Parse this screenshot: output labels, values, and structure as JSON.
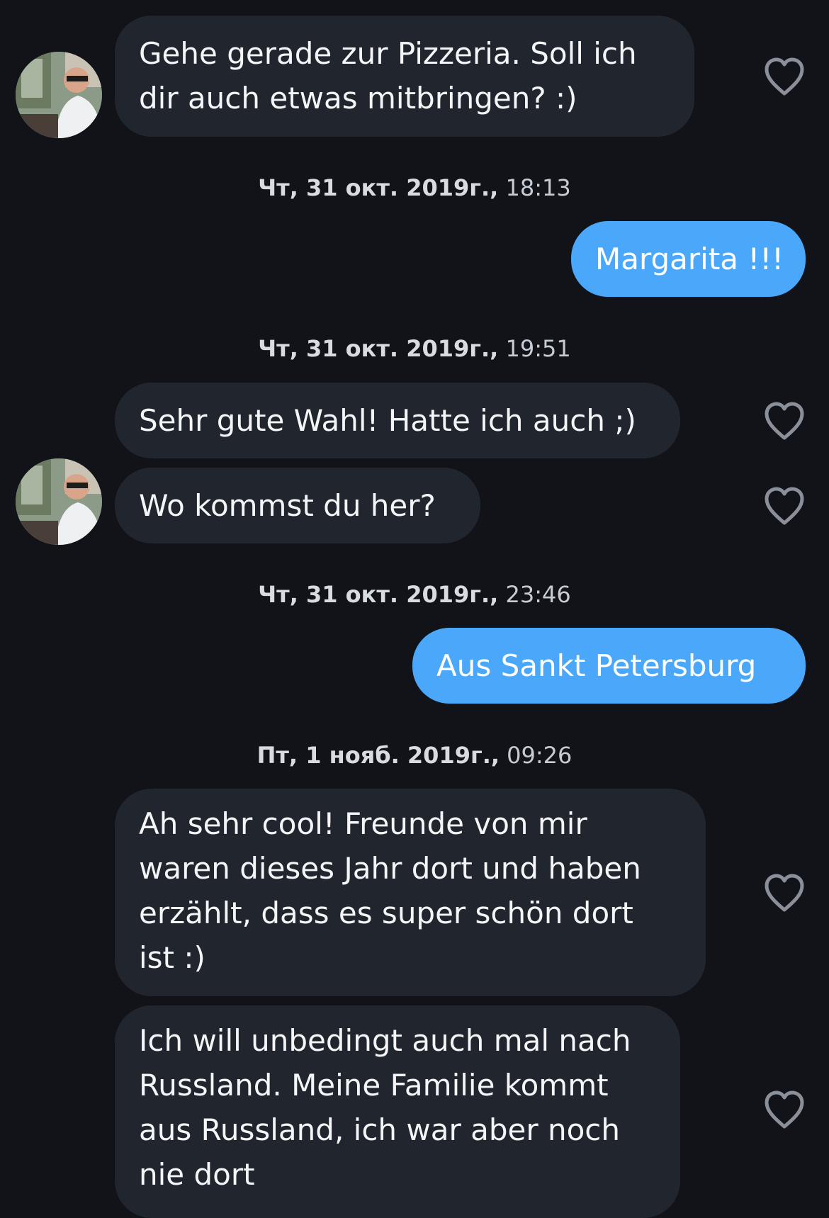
{
  "messages": {
    "m1": "Gehe gerade zur Pizzeria. Soll ich\ndir auch etwas mitbringen? :)",
    "m2": "Margarita !!!",
    "m3": "Sehr gute Wahl! Hatte ich auch ;)",
    "m4": "Wo kommst du her?",
    "m5": "Aus Sankt Petersburg",
    "m6": "Ah sehr cool! Freunde von mir\nwaren dieses Jahr dort und haben\nerzählt, dass es super schön dort\nist :)",
    "m7": "Ich will unbedingt auch mal nach\nRussland. Meine Familie kommt\naus Russland, ich war aber noch\nnie dort"
  },
  "timestamps": {
    "t1": {
      "date": "Чт, 31 окт. 2019г.,",
      "time": " 18:13"
    },
    "t2": {
      "date": "Чт, 31 окт. 2019г.,",
      "time": " 19:51"
    },
    "t3": {
      "date": "Чт, 31 окт. 2019г.,",
      "time": " 23:46"
    },
    "t4": {
      "date": "Пт, 1 нояб. 2019г.,",
      "time": " 09:26"
    }
  },
  "icons": {
    "like": "heart-outline-icon",
    "avatar": "contact-avatar"
  },
  "colors": {
    "background": "#111318",
    "incoming_bubble": "#21252e",
    "outgoing_bubble": "#4aa7f9",
    "timestamp_text": "#c7cbd3",
    "heart_outline": "#8a8f99"
  }
}
